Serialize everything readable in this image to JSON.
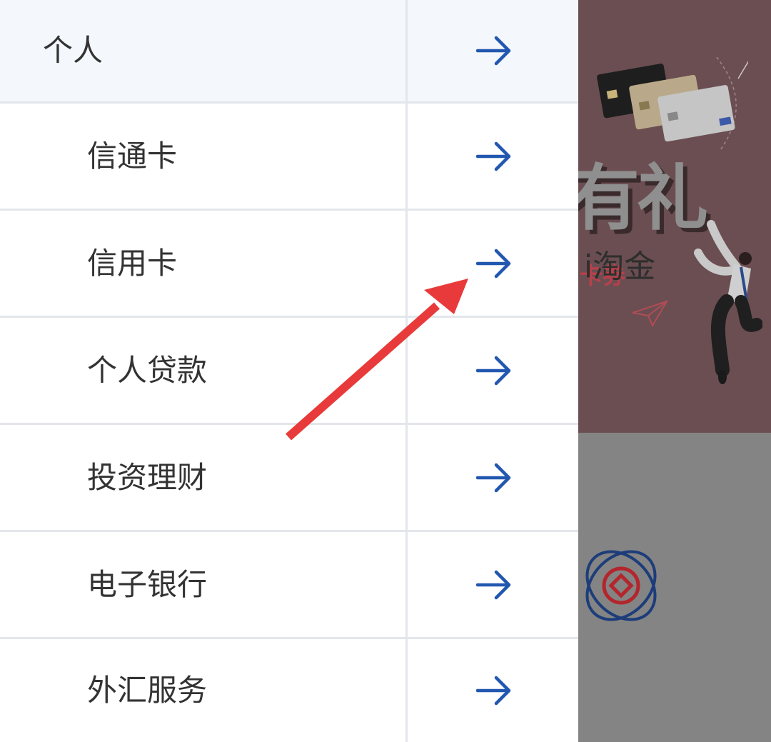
{
  "menu": {
    "items": [
      {
        "label": "个人"
      },
      {
        "label": "信通卡"
      },
      {
        "label": "信用卡"
      },
      {
        "label": "个人贷款"
      },
      {
        "label": "投资理财"
      },
      {
        "label": "电子银行"
      },
      {
        "label": "外汇服务"
      }
    ],
    "arrow_icon": "arrow-right-icon"
  },
  "background": {
    "banner_title": "有礼",
    "banner_subtitle": "卡券",
    "service_label": "i淘金"
  },
  "colors": {
    "arrow_blue": "#2257b0",
    "annotation_red": "#e83a3a",
    "banner_bg": "#6b4e52",
    "header_bg": "#f4f7fb",
    "divider": "#e3e6ea"
  }
}
